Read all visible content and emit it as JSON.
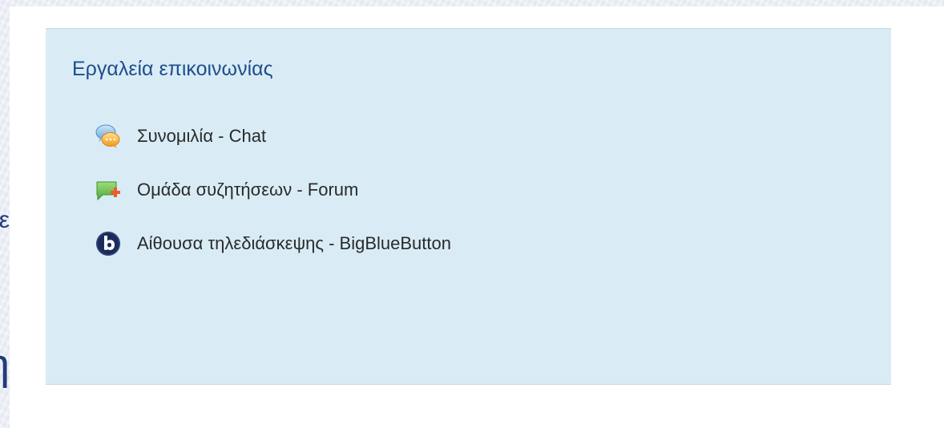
{
  "left_fragments": {
    "first": "ε",
    "second": "η"
  },
  "communication_block": {
    "title": "Εργαλεία επικοινωνίας",
    "items": [
      {
        "label": "Συνομιλία - Chat",
        "icon": "chat-bubbles-icon"
      },
      {
        "label": "Ομάδα συζητήσεων - Forum",
        "icon": "forum-icon"
      },
      {
        "label": "Αίθουσα τηλεδιάσκεψης - BigBlueButton",
        "icon": "bigbluebutton-icon"
      }
    ]
  },
  "colors": {
    "panel_background": "#d9ecf6",
    "title": "#1f4d8c",
    "item_text": "#2a2a2a",
    "page_background": "#eceff6",
    "bigbluebutton_icon": "#1c2c5a"
  }
}
